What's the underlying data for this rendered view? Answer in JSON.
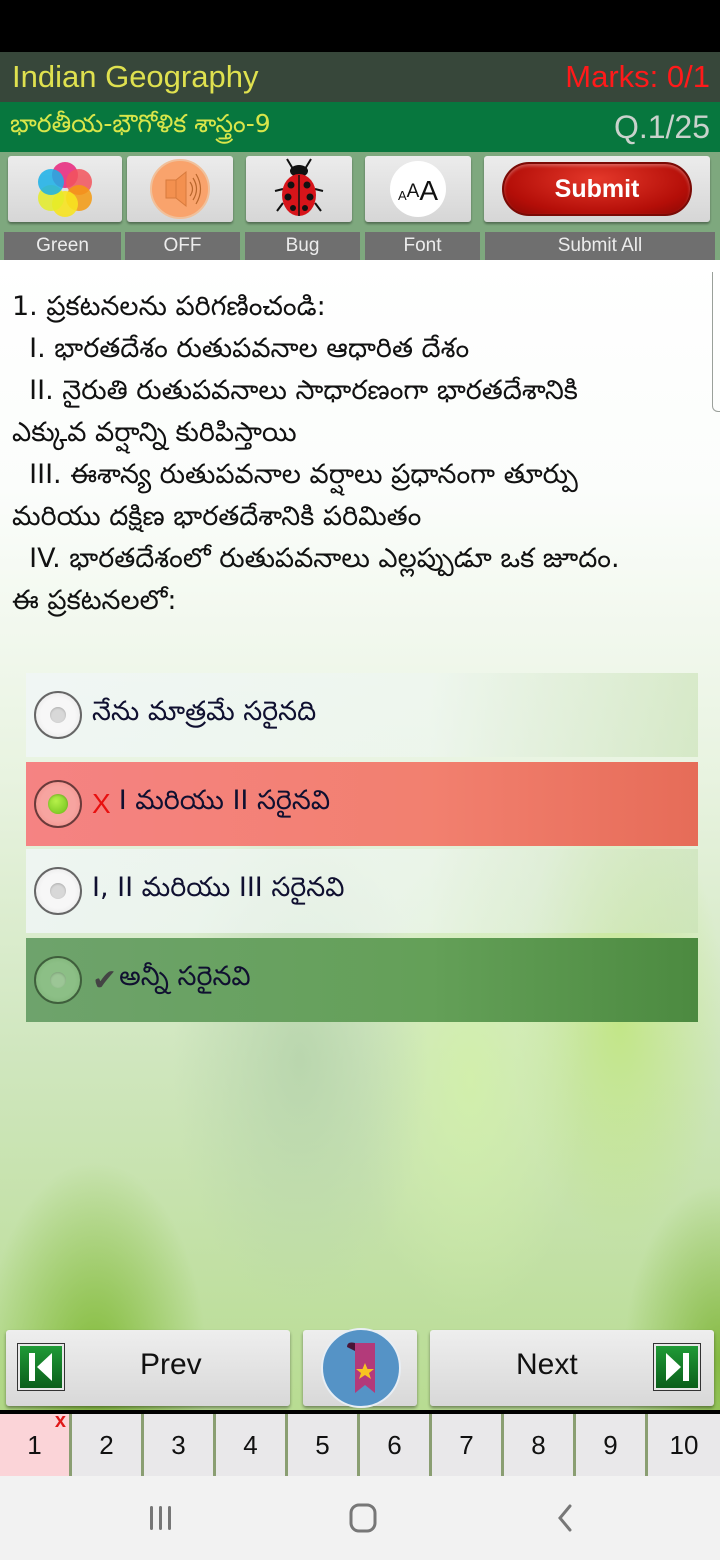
{
  "header": {
    "app_title": "Indian Geography",
    "marks": "Marks: 0/1",
    "subtitle": "భారతీయ-భౌగోళిక శాస్త్రం-9",
    "question_counter": "Q.1/25",
    "colors": {
      "title_bar_bg": "#37473a",
      "title_text": "#dfe14f",
      "marks_text": "#ff1a1a",
      "subtitle_bar_bg": "#07773e"
    }
  },
  "toolbar": {
    "items": [
      {
        "label": "Green",
        "icon": "color-palette-icon"
      },
      {
        "label": "OFF",
        "icon": "speaker-icon"
      },
      {
        "label": "Bug",
        "icon": "ladybug-icon"
      },
      {
        "label": "Font",
        "icon": "font-size-icon",
        "icon_text_small": "A",
        "icon_text_mid": "A",
        "icon_text_big": "A"
      },
      {
        "label": "Submit All",
        "button_text": "Submit"
      }
    ]
  },
  "question": {
    "lines": [
      "1. ప్రకటనలను పరిగణించండి:",
      "  I. భారతదేశం రుతుపవనాల ఆధారిత దేశం",
      "  II. నైరుతి రుతుపవనాలు సాధారణంగా భారతదేశానికి",
      "ఎక్కువ వర్షాన్ని కురిపిస్తాయి",
      "  III. ఈశాన్య రుతుపవనాల వర్షాలు ప్రధానంగా తూర్పు",
      "మరియు దక్షిణ భారతదేశానికి పరిమితం",
      "  IV. భారతదేశంలో రుతుపవనాలు ఎల్లప్పుడూ ఒక జూదం.",
      "ఈ ప్రకటనలలో:"
    ]
  },
  "options": [
    {
      "text": "నేను మాత్రమే సరైనది",
      "state": "plain",
      "selected": false,
      "mark": ""
    },
    {
      "text": "I మరియు II సరైనవి",
      "state": "wrong",
      "selected": true,
      "mark": "X"
    },
    {
      "text": "I, II మరియు III సరైనవి",
      "state": "plain",
      "selected": false,
      "mark": ""
    },
    {
      "text": "అన్నీ సరైనవి",
      "state": "correct",
      "selected": false,
      "mark": "✔"
    }
  ],
  "navigation": {
    "prev_label": "Prev",
    "next_label": "Next",
    "bookmark_icon": "bookmark-icon"
  },
  "question_nav": {
    "numbers": [
      "1",
      "2",
      "3",
      "4",
      "5",
      "6",
      "7",
      "8",
      "9",
      "10"
    ],
    "wrong_mark": "x",
    "current_state": "wrong"
  },
  "system_nav": {
    "recents_icon": "recents-icon",
    "home_icon": "home-icon",
    "back_icon": "back-icon"
  }
}
